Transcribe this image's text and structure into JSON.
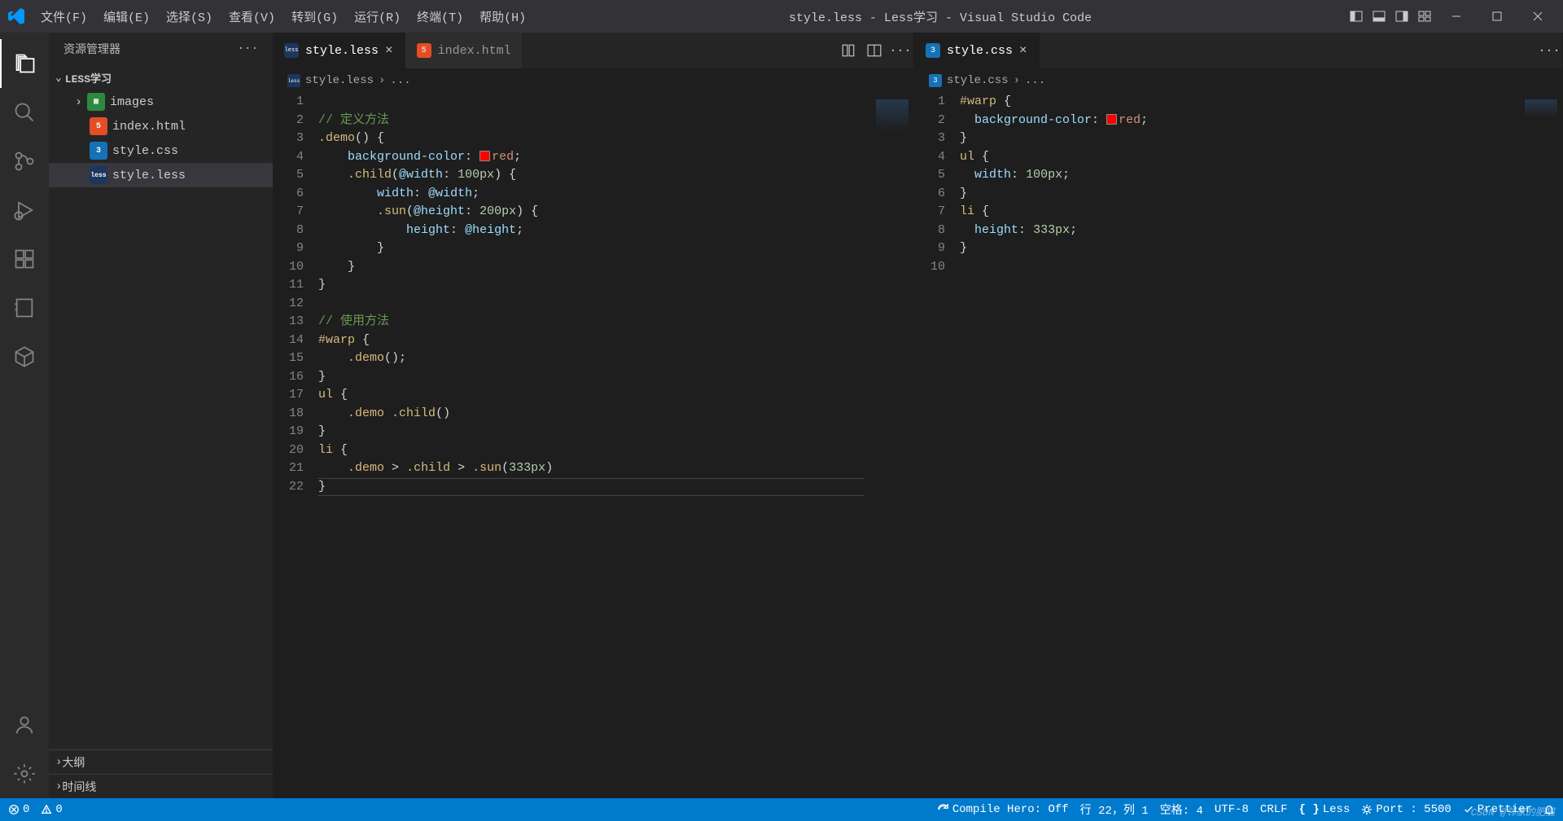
{
  "menu": [
    "文件(F)",
    "编辑(E)",
    "选择(S)",
    "查看(V)",
    "转到(G)",
    "运行(R)",
    "终端(T)",
    "帮助(H)"
  ],
  "title": "style.less - Less学习 - Visual Studio Code",
  "sidebar": {
    "title": "资源管理器",
    "project": "LESS学习",
    "items": [
      {
        "label": "images",
        "icon": "ic-folder",
        "chev": ">"
      },
      {
        "label": "index.html",
        "icon": "ic-html"
      },
      {
        "label": "style.css",
        "icon": "ic-css"
      },
      {
        "label": "style.less",
        "icon": "ic-less",
        "selected": true
      }
    ],
    "panels": [
      "大纲",
      "时间线"
    ]
  },
  "editor1": {
    "tabs": [
      {
        "label": "style.less",
        "icon": "ic-less",
        "active": true,
        "close": true
      },
      {
        "label": "index.html",
        "icon": "ic-html"
      }
    ],
    "breadcrumb": [
      "style.less",
      "..."
    ],
    "lines": 22
  },
  "editor2": {
    "tabs": [
      {
        "label": "style.css",
        "icon": "ic-css",
        "active": true,
        "close": true
      }
    ],
    "breadcrumb": [
      "style.css",
      "..."
    ],
    "lines": 10
  },
  "status": {
    "errors": "0",
    "warnings": "0",
    "compile": "Compile Hero: Off",
    "pos": "行 22，列 1",
    "spaces": "空格: 4",
    "enc": "UTF-8",
    "eol": "CRLF",
    "lang": "Less",
    "port": "Port : 5500",
    "prettier": "Prettier"
  },
  "watermark": "CSDN @邻家的肥猫"
}
